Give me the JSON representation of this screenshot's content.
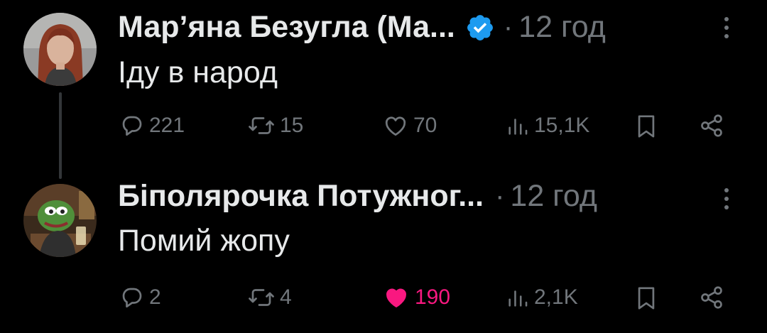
{
  "tweets": [
    {
      "author": "Мар’яна Безугла (Ма...",
      "verified": true,
      "separator": "·",
      "time": "12 год",
      "text": "Іду в народ",
      "replies": "221",
      "reposts": "15",
      "likes": "70",
      "views": "15,1K",
      "liked": false
    },
    {
      "author": "Біполярочка Потужног...",
      "verified": false,
      "separator": "·",
      "time": "12 год",
      "text": "Помий жопу",
      "replies": "2",
      "reposts": "4",
      "likes": "190",
      "views": "2,1K",
      "liked": true
    }
  ],
  "colors": {
    "background": "#000000",
    "text": "#e7e9ea",
    "muted": "#71767b",
    "verified": "#1d9bf0",
    "like": "#f91880"
  },
  "icons": [
    "reply-icon",
    "repost-icon",
    "like-icon",
    "views-icon",
    "bookmark-icon",
    "share-icon",
    "more-icon",
    "verified-badge-icon"
  ]
}
